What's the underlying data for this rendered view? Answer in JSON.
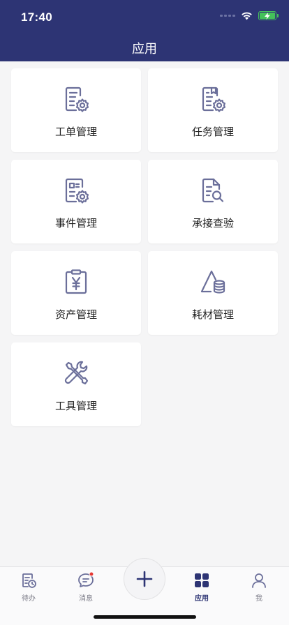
{
  "status_bar": {
    "time": "17:40"
  },
  "header": {
    "title": "应用"
  },
  "apps": [
    {
      "label": "工单管理",
      "icon": "work-order-gear-icon"
    },
    {
      "label": "任务管理",
      "icon": "task-clipboard-gear-icon"
    },
    {
      "label": "事件管理",
      "icon": "event-list-gear-icon"
    },
    {
      "label": "承接查验",
      "icon": "document-search-icon"
    },
    {
      "label": "资产管理",
      "icon": "asset-yen-icon"
    },
    {
      "label": "耗材管理",
      "icon": "consumable-stack-icon"
    },
    {
      "label": "工具管理",
      "icon": "tools-wrench-screwdriver-icon"
    }
  ],
  "tabbar": {
    "items": [
      {
        "label": "待办",
        "icon": "todo-icon",
        "active": false
      },
      {
        "label": "消息",
        "icon": "message-icon",
        "active": false,
        "badge": true
      },
      {
        "label": "应用",
        "icon": "apps-grid-icon",
        "active": true
      },
      {
        "label": "我",
        "icon": "user-icon",
        "active": false
      }
    ],
    "plus_icon": "plus-icon"
  },
  "colors": {
    "primary": "#2d3474",
    "icon": "#6b6f9a",
    "badge": "#e53935",
    "battery": "#44c15a"
  }
}
